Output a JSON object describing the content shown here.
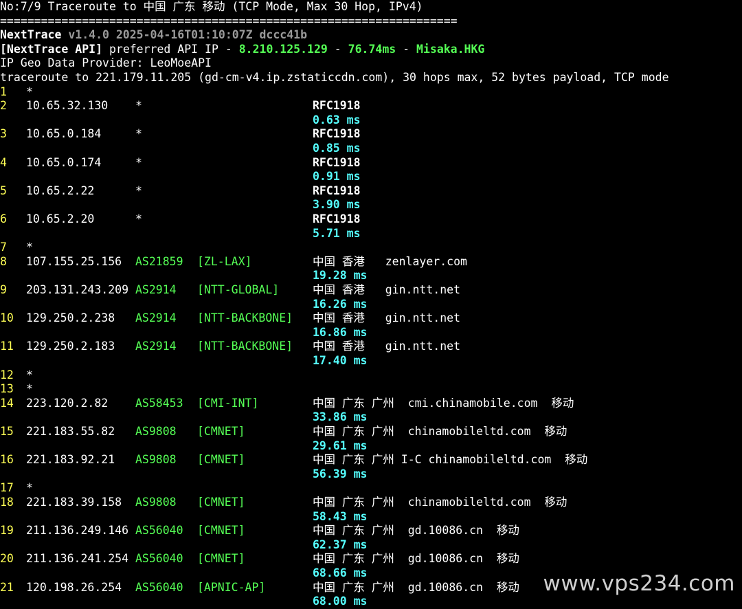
{
  "header": {
    "title": "No:7/9 Traceroute to 中国 广东 移动 (TCP Mode, Max 30 Hop, IPv4)",
    "separator": "===================================================================",
    "app_name": "NextTrace",
    "app_version": " v1.4.0 2025-04-16T01:10:07Z dccc41b",
    "api_label": "[NextTrace API]",
    "api_text": " preferred API IP - ",
    "api_ip": "8.210.125.129",
    "api_dash1": " - ",
    "api_latency": "76.74ms",
    "api_dash2": " - ",
    "api_node": "Misaka.HKG",
    "geo_provider": "IP Geo Data Provider: LeoMoeAPI",
    "traceroute_line": "traceroute to 221.179.11.205 (gd-cm-v4.ip.zstaticcdn.com), 30 hops max, 52 bytes payload, TCP mode"
  },
  "hops": [
    {
      "hop": "1",
      "star": "*"
    },
    {
      "hop": "2",
      "ip": "10.65.32.130",
      "as": "*",
      "tag": "",
      "geo": "RFC1918",
      "rtt": "0.63 ms"
    },
    {
      "hop": "3",
      "ip": "10.65.0.184",
      "as": "*",
      "tag": "",
      "geo": "RFC1918",
      "rtt": "0.85 ms"
    },
    {
      "hop": "4",
      "ip": "10.65.0.174",
      "as": "*",
      "tag": "",
      "geo": "RFC1918",
      "rtt": "0.91 ms"
    },
    {
      "hop": "5",
      "ip": "10.65.2.22",
      "as": "*",
      "tag": "",
      "geo": "RFC1918",
      "rtt": "3.90 ms"
    },
    {
      "hop": "6",
      "ip": "10.65.2.20",
      "as": "*",
      "tag": "",
      "geo": "RFC1918",
      "rtt": "5.71 ms"
    },
    {
      "hop": "7",
      "star": "*"
    },
    {
      "hop": "8",
      "ip": "107.155.25.156",
      "as": "AS21859",
      "tag": "[ZL-LAX]",
      "geo": "中国 香港   zenlayer.com",
      "rtt": "19.28 ms"
    },
    {
      "hop": "9",
      "ip": "203.131.243.209",
      "as": "AS2914",
      "tag": "[NTT-GLOBAL]",
      "geo": "中国 香港   gin.ntt.net",
      "rtt": "16.26 ms"
    },
    {
      "hop": "10",
      "ip": "129.250.2.238",
      "as": "AS2914",
      "tag": "[NTT-BACKBONE]",
      "geo": "中国 香港   gin.ntt.net",
      "rtt": "16.86 ms"
    },
    {
      "hop": "11",
      "ip": "129.250.2.183",
      "as": "AS2914",
      "tag": "[NTT-BACKBONE]",
      "geo": "中国 香港   gin.ntt.net",
      "rtt": "17.40 ms"
    },
    {
      "hop": "12",
      "star": "*"
    },
    {
      "hop": "13",
      "star": "*"
    },
    {
      "hop": "14",
      "ip": "223.120.2.82",
      "as": "AS58453",
      "tag": "[CMI-INT]",
      "geo": "中国 广东 广州  cmi.chinamobile.com  移动",
      "rtt": "33.86 ms"
    },
    {
      "hop": "15",
      "ip": "221.183.55.82",
      "as": "AS9808",
      "tag": "[CMNET]",
      "geo": "中国 广东 广州  chinamobileltd.com  移动",
      "rtt": "29.61 ms"
    },
    {
      "hop": "16",
      "ip": "221.183.92.21",
      "as": "AS9808",
      "tag": "[CMNET]",
      "geo": "中国 广东 广州 I-C chinamobileltd.com  移动",
      "rtt": "56.39 ms"
    },
    {
      "hop": "17",
      "star": "*"
    },
    {
      "hop": "18",
      "ip": "221.183.39.158",
      "as": "AS9808",
      "tag": "[CMNET]",
      "geo": "中国 广东 广州  chinamobileltd.com  移动",
      "rtt": "58.43 ms"
    },
    {
      "hop": "19",
      "ip": "211.136.249.146",
      "as": "AS56040",
      "tag": "[CMNET]",
      "geo": "中国 广东 广州  gd.10086.cn  移动",
      "rtt": "62.37 ms"
    },
    {
      "hop": "20",
      "ip": "211.136.241.254",
      "as": "AS56040",
      "tag": "[CMNET]",
      "geo": "中国 广东 广州  gd.10086.cn  移动",
      "rtt": "68.66 ms"
    },
    {
      "hop": "21",
      "ip": "120.198.26.254",
      "as": "AS56040",
      "tag": "[APNIC-AP]",
      "geo": "中国 广东 广州  gd.10086.cn  移动",
      "rtt": "68.00 ms"
    }
  ],
  "watermark": "www.vps234.com",
  "colors": {
    "background": "#000000",
    "hop_number": "#ffff55",
    "asn": "#55ff55",
    "rtt": "#55ffff",
    "text": "#ffffff"
  }
}
